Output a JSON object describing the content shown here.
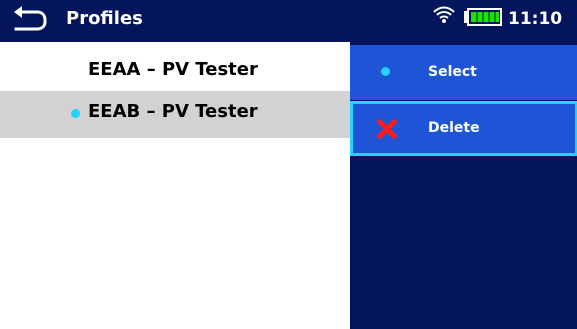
{
  "header": {
    "title": "Profiles",
    "time": "11:10",
    "back_icon": "back-arrow-icon",
    "wifi_icon": "wifi-icon",
    "battery_icon": "battery-icon",
    "battery_level": 1.0
  },
  "profiles": [
    {
      "label": "EEAA – PV Tester",
      "selected": false
    },
    {
      "label": "EEAB – PV Tester",
      "selected": true,
      "indicator_icon": "selection-dot-icon"
    }
  ],
  "menu": {
    "items": [
      {
        "label": "Select",
        "icon": "selection-dot-icon",
        "focused": false
      },
      {
        "label": "Delete",
        "icon": "delete-x-icon",
        "focused": true
      }
    ]
  },
  "colors": {
    "header_background": "#04155c",
    "menu_background": "#04155c",
    "menu_item_background": "#1d55d6",
    "selected_row_background": "#d2d2d2",
    "accent_cyan": "#22d3ff",
    "battery_green": "#14e600",
    "delete_red": "#ff1b1b"
  }
}
